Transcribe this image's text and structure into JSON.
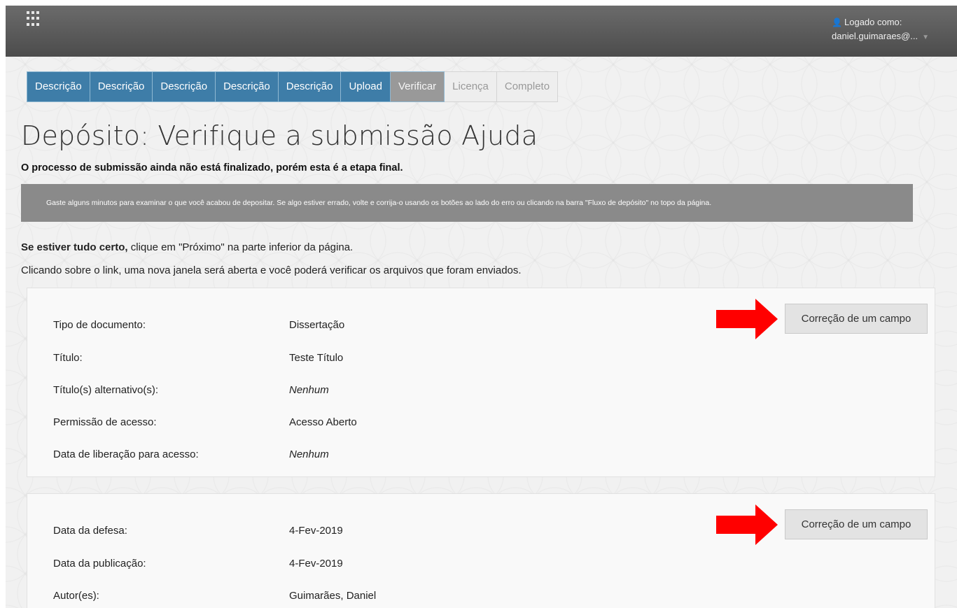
{
  "header": {
    "logged_as_label": "Logado como:",
    "user_email": "daniel.guimaraes@..."
  },
  "steps": [
    {
      "label": "Descrição",
      "state": "done"
    },
    {
      "label": "Descrição",
      "state": "done"
    },
    {
      "label": "Descrição",
      "state": "done"
    },
    {
      "label": "Descrição",
      "state": "done"
    },
    {
      "label": "Descrição",
      "state": "done"
    },
    {
      "label": "Upload",
      "state": "done"
    },
    {
      "label": "Verificar",
      "state": "current"
    },
    {
      "label": "Licença",
      "state": "future"
    },
    {
      "label": "Completo",
      "state": "future"
    }
  ],
  "page": {
    "title": "Depósito: Verifique a submissão Ajuda",
    "subtitle": "O processo de submissão ainda não está finalizado, porém esta é a etapa final.",
    "notice": "Gaste alguns minutos para examinar o que você acabou de depositar. Se algo estiver errado, volte e corrija-o usando os botões ao lado do erro ou clicando na barra \"Fluxo de depósito\" no topo da página.",
    "line1_bold": "Se estiver tudo certo,",
    "line1_rest": " clique em \"Próximo\" na parte inferior da página.",
    "line2": "Clicando sobre o link, uma nova janela será aberta e você poderá verificar os arquivos que foram enviados."
  },
  "panels": [
    {
      "button": "Correção de um campo",
      "rows": [
        {
          "label": "Tipo de documento:",
          "value": "Dissertação"
        },
        {
          "label": "Título:",
          "value": "Teste Título"
        },
        {
          "label": "Título(s) alternativo(s):",
          "value": "Nenhum"
        },
        {
          "label": "Permissão de acesso:",
          "value": "Acesso Aberto"
        },
        {
          "label": "Data de liberação para acesso:",
          "value": "Nenhum"
        }
      ]
    },
    {
      "button": "Correção de um campo",
      "rows": [
        {
          "label": "Data da defesa:",
          "value": "4-Fev-2019"
        },
        {
          "label": "Data da publicação:",
          "value": "4-Fev-2019"
        },
        {
          "label": "Autor(es):",
          "value": "Guimarães, Daniel"
        }
      ]
    }
  ],
  "colors": {
    "step_done": "#3e7da8",
    "step_current": "#999999",
    "arrow": "#ff0000"
  }
}
